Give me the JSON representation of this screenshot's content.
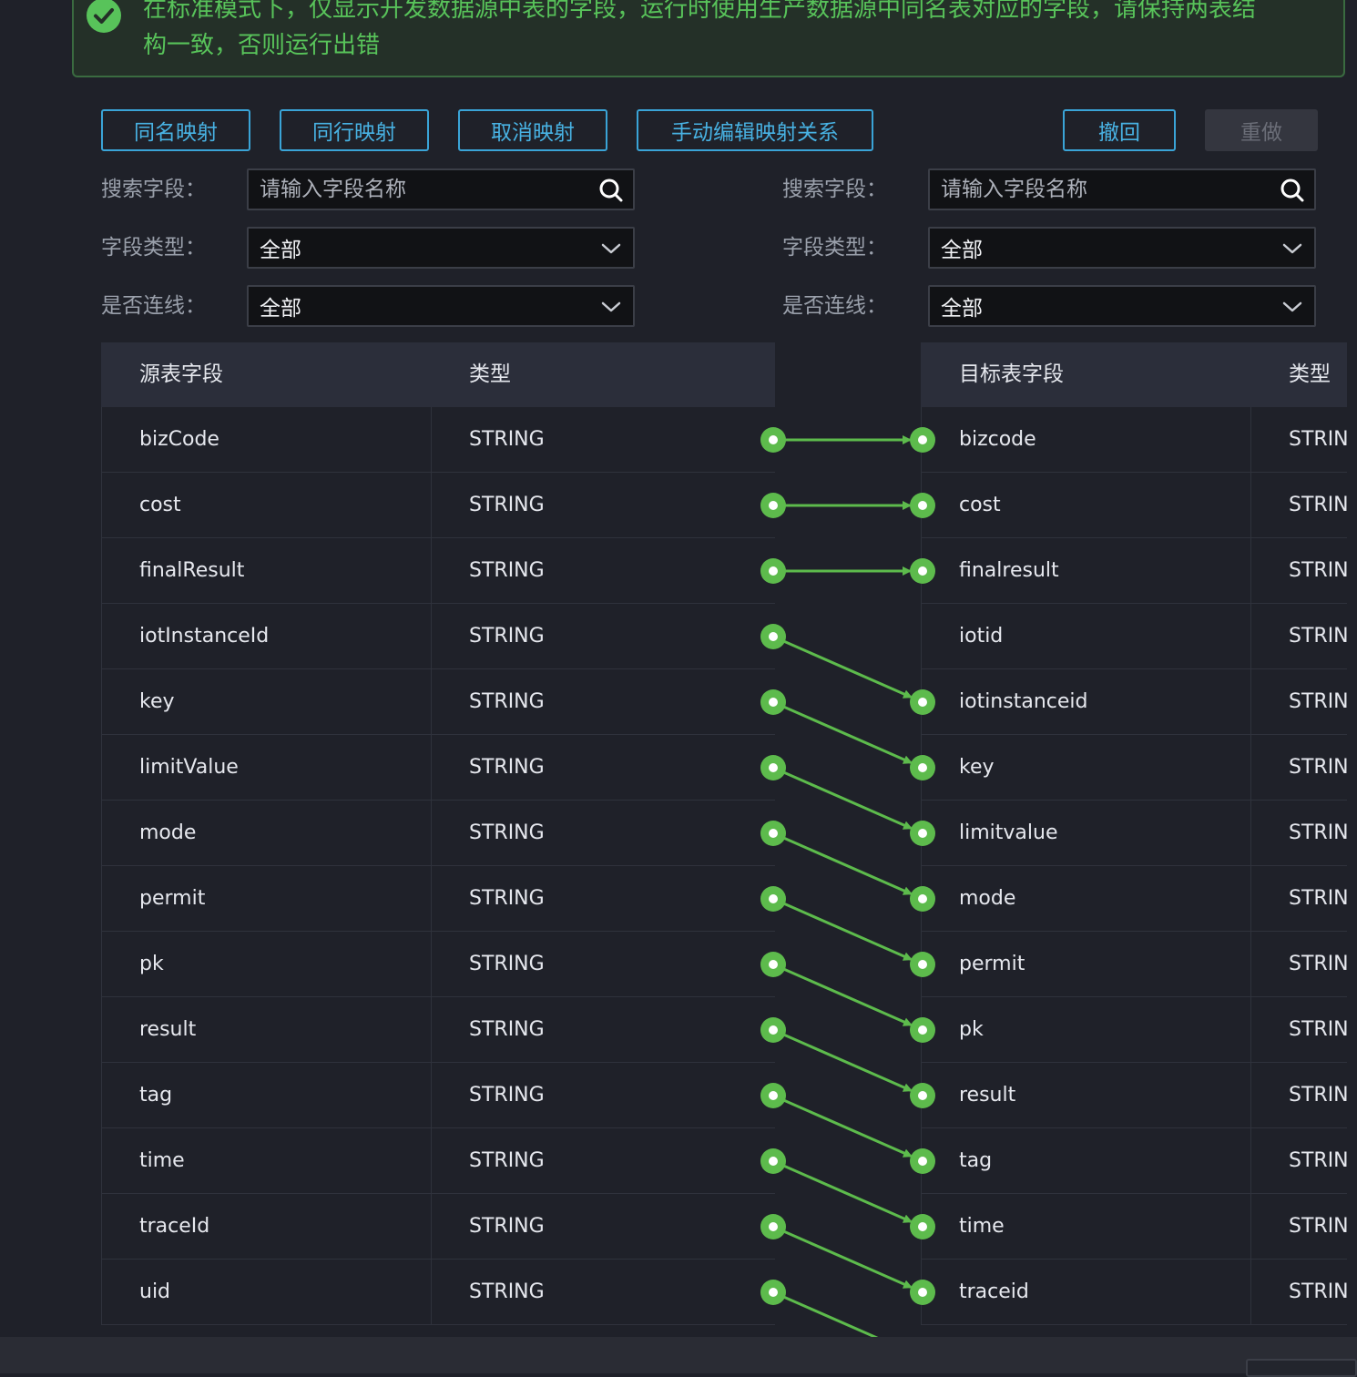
{
  "notice": {
    "icon": "check-circle-icon",
    "text": "在标准模式下，仅显示开发数据源中表的字段，运行时使用生产数据源中同名表对应的字段，请保持两表结构一致，否则运行出错",
    "color": "#58c35a"
  },
  "toolbar": {
    "same_name": "同名映射",
    "same_row": "同行映射",
    "cancel": "取消映射",
    "manual": "手动编辑映射关系",
    "undo": "撤回",
    "redo": "重做"
  },
  "filters": {
    "left": {
      "search_label": "搜索字段：",
      "search_placeholder": "请输入字段名称",
      "type_label": "字段类型：",
      "type_value": "全部",
      "link_label": "是否连线：",
      "link_value": "全部"
    },
    "right": {
      "search_label": "搜索字段：",
      "search_placeholder": "请输入字段名称",
      "type_label": "字段类型：",
      "type_value": "全部",
      "link_label": "是否连线：",
      "link_value": "全部"
    }
  },
  "source_table": {
    "headers": {
      "field": "源表字段",
      "type": "类型"
    },
    "rows": [
      {
        "field": "bizCode",
        "type": "STRING"
      },
      {
        "field": "cost",
        "type": "STRING"
      },
      {
        "field": "finalResult",
        "type": "STRING"
      },
      {
        "field": "iotInstanceId",
        "type": "STRING"
      },
      {
        "field": "key",
        "type": "STRING"
      },
      {
        "field": "limitValue",
        "type": "STRING"
      },
      {
        "field": "mode",
        "type": "STRING"
      },
      {
        "field": "permit",
        "type": "STRING"
      },
      {
        "field": "pk",
        "type": "STRING"
      },
      {
        "field": "result",
        "type": "STRING"
      },
      {
        "field": "tag",
        "type": "STRING"
      },
      {
        "field": "time",
        "type": "STRING"
      },
      {
        "field": "traceId",
        "type": "STRING"
      },
      {
        "field": "uid",
        "type": "STRING"
      }
    ]
  },
  "target_table": {
    "headers": {
      "field": "目标表字段",
      "type": "类型"
    },
    "rows": [
      {
        "field": "bizcode",
        "type": "STRIN"
      },
      {
        "field": "cost",
        "type": "STRIN"
      },
      {
        "field": "finalresult",
        "type": "STRIN"
      },
      {
        "field": "iotid",
        "type": "STRIN"
      },
      {
        "field": "iotinstanceid",
        "type": "STRIN"
      },
      {
        "field": "key",
        "type": "STRIN"
      },
      {
        "field": "limitvalue",
        "type": "STRIN"
      },
      {
        "field": "mode",
        "type": "STRIN"
      },
      {
        "field": "permit",
        "type": "STRIN"
      },
      {
        "field": "pk",
        "type": "STRIN"
      },
      {
        "field": "result",
        "type": "STRIN"
      },
      {
        "field": "tag",
        "type": "STRIN"
      },
      {
        "field": "time",
        "type": "STRIN"
      },
      {
        "field": "traceid",
        "type": "STRIN"
      }
    ]
  },
  "mappings": [
    [
      0,
      0
    ],
    [
      1,
      1
    ],
    [
      2,
      2
    ],
    [
      3,
      4
    ],
    [
      4,
      5
    ],
    [
      5,
      6
    ],
    [
      6,
      7
    ],
    [
      7,
      8
    ],
    [
      8,
      9
    ],
    [
      9,
      10
    ],
    [
      10,
      11
    ],
    [
      11,
      12
    ],
    [
      12,
      13
    ],
    [
      13,
      14
    ]
  ],
  "colors": {
    "accent": "#3aa4d7",
    "link": "#5dbb4c",
    "bg": "#1f2129"
  }
}
